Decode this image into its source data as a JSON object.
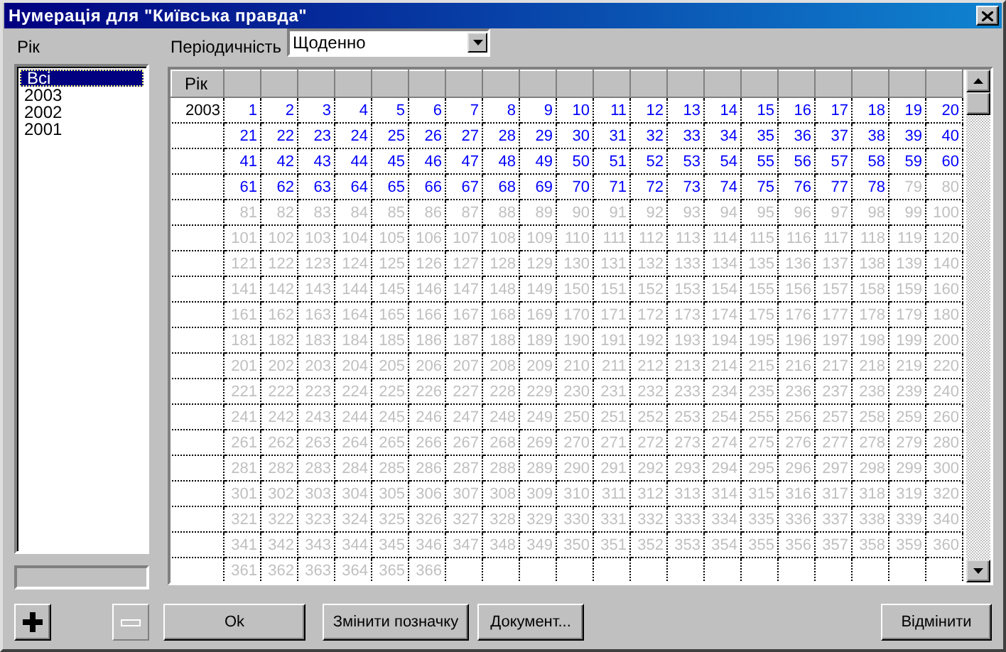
{
  "window": {
    "title": "Нумерація для \"Київська правда\""
  },
  "year_panel": {
    "label": "Рік",
    "items": [
      {
        "label": "Всі",
        "selected": true
      },
      {
        "label": "2003",
        "selected": false
      },
      {
        "label": "2002",
        "selected": false
      },
      {
        "label": "2001",
        "selected": false
      }
    ]
  },
  "periodicity": {
    "label": "Періодичність",
    "value": "Щоденно"
  },
  "grid": {
    "year_header": "Рік",
    "rows": [
      {
        "year": "2003",
        "cells": [
          {
            "number": "1",
            "issued": true
          },
          {
            "number": "2",
            "issued": true
          },
          {
            "number": "3",
            "issued": true
          },
          {
            "number": "4",
            "issued": true
          },
          {
            "number": "5",
            "issued": true
          },
          {
            "number": "6",
            "issued": true
          },
          {
            "number": "7",
            "issued": true
          },
          {
            "number": "8",
            "issued": true
          },
          {
            "number": "9",
            "issued": true
          },
          {
            "number": "10",
            "issued": true
          },
          {
            "number": "11",
            "issued": true
          },
          {
            "number": "12",
            "issued": true
          },
          {
            "number": "13",
            "issued": true
          },
          {
            "number": "14",
            "issued": true
          },
          {
            "number": "15",
            "issued": true
          },
          {
            "number": "16",
            "issued": true
          },
          {
            "number": "17",
            "issued": true
          },
          {
            "number": "18",
            "issued": true
          },
          {
            "number": "19",
            "issued": true
          },
          {
            "number": "20",
            "issued": true
          }
        ]
      },
      {
        "cells": [
          {
            "number": "21",
            "issued": true
          },
          {
            "number": "22",
            "issued": true
          },
          {
            "number": "23",
            "issued": true
          },
          {
            "number": "24",
            "issued": true
          },
          {
            "number": "25",
            "issued": true
          },
          {
            "number": "26",
            "issued": true
          },
          {
            "number": "27",
            "issued": true
          },
          {
            "number": "28",
            "issued": true
          },
          {
            "number": "29",
            "issued": true
          },
          {
            "number": "30",
            "issued": true
          },
          {
            "number": "31",
            "issued": true
          },
          {
            "number": "32",
            "issued": true
          },
          {
            "number": "33",
            "issued": true
          },
          {
            "number": "34",
            "issued": true
          },
          {
            "number": "35",
            "issued": true
          },
          {
            "number": "36",
            "issued": true
          },
          {
            "number": "37",
            "issued": true
          },
          {
            "number": "38",
            "issued": true
          },
          {
            "number": "39",
            "issued": true
          },
          {
            "number": "40",
            "issued": true
          }
        ]
      },
      {
        "cells": [
          {
            "number": "41",
            "issued": true
          },
          {
            "number": "42",
            "issued": true
          },
          {
            "number": "43",
            "issued": true
          },
          {
            "number": "44",
            "issued": true
          },
          {
            "number": "45",
            "issued": true
          },
          {
            "number": "46",
            "issued": true
          },
          {
            "number": "47",
            "issued": true
          },
          {
            "number": "48",
            "issued": true
          },
          {
            "number": "49",
            "issued": true
          },
          {
            "number": "50",
            "issued": true
          },
          {
            "number": "51",
            "issued": true
          },
          {
            "number": "52",
            "issued": true
          },
          {
            "number": "53",
            "issued": true
          },
          {
            "number": "54",
            "issued": true
          },
          {
            "number": "55",
            "issued": true
          },
          {
            "number": "56",
            "issued": true
          },
          {
            "number": "57",
            "issued": true
          },
          {
            "number": "58",
            "issued": true
          },
          {
            "number": "59",
            "issued": true
          },
          {
            "number": "60",
            "issued": true
          }
        ]
      },
      {
        "cells": [
          {
            "number": "61",
            "issued": true
          },
          {
            "number": "62",
            "issued": true
          },
          {
            "number": "63",
            "issued": true
          },
          {
            "number": "64",
            "issued": true
          },
          {
            "number": "65",
            "issued": true
          },
          {
            "number": "66",
            "issued": true
          },
          {
            "number": "67",
            "issued": true
          },
          {
            "number": "68",
            "issued": true
          },
          {
            "number": "69",
            "issued": true
          },
          {
            "number": "70",
            "issued": true
          },
          {
            "number": "71",
            "issued": true
          },
          {
            "number": "72",
            "issued": true
          },
          {
            "number": "73",
            "issued": true
          },
          {
            "number": "74",
            "issued": true
          },
          {
            "number": "75",
            "issued": true
          },
          {
            "number": "76",
            "issued": true
          },
          {
            "number": "77",
            "issued": true
          },
          {
            "number": "78",
            "issued": true
          },
          {
            "number": "79",
            "issued": false
          },
          {
            "number": "80",
            "issued": false
          }
        ]
      },
      {
        "cells": [
          {
            "number": "81",
            "issued": false
          },
          {
            "number": "82",
            "issued": false
          },
          {
            "number": "83",
            "issued": false
          },
          {
            "number": "84",
            "issued": false
          },
          {
            "number": "85",
            "issued": false
          },
          {
            "number": "86",
            "issued": false
          },
          {
            "number": "87",
            "issued": false
          },
          {
            "number": "88",
            "issued": false
          },
          {
            "number": "89",
            "issued": false
          },
          {
            "number": "90",
            "issued": false
          },
          {
            "number": "91",
            "issued": false
          },
          {
            "number": "92",
            "issued": false
          },
          {
            "number": "93",
            "issued": false
          },
          {
            "number": "94",
            "issued": false
          },
          {
            "number": "95",
            "issued": false
          },
          {
            "number": "96",
            "issued": false
          },
          {
            "number": "97",
            "issued": false
          },
          {
            "number": "98",
            "issued": false
          },
          {
            "number": "99",
            "issued": false
          },
          {
            "number": "100",
            "issued": false
          }
        ]
      },
      {
        "cells": [
          {
            "number": "101",
            "issued": false
          },
          {
            "number": "102",
            "issued": false
          },
          {
            "number": "103",
            "issued": false
          },
          {
            "number": "104",
            "issued": false
          },
          {
            "number": "105",
            "issued": false
          },
          {
            "number": "106",
            "issued": false
          },
          {
            "number": "107",
            "issued": false
          },
          {
            "number": "108",
            "issued": false
          },
          {
            "number": "109",
            "issued": false
          },
          {
            "number": "110",
            "issued": false
          },
          {
            "number": "111",
            "issued": false
          },
          {
            "number": "112",
            "issued": false
          },
          {
            "number": "113",
            "issued": false
          },
          {
            "number": "114",
            "issued": false
          },
          {
            "number": "115",
            "issued": false
          },
          {
            "number": "116",
            "issued": false
          },
          {
            "number": "117",
            "issued": false
          },
          {
            "number": "118",
            "issued": false
          },
          {
            "number": "119",
            "issued": false
          },
          {
            "number": "120",
            "issued": false
          }
        ]
      },
      {
        "cells": [
          {
            "number": "121",
            "issued": false
          },
          {
            "number": "122",
            "issued": false
          },
          {
            "number": "123",
            "issued": false
          },
          {
            "number": "124",
            "issued": false
          },
          {
            "number": "125",
            "issued": false
          },
          {
            "number": "126",
            "issued": false
          },
          {
            "number": "127",
            "issued": false
          },
          {
            "number": "128",
            "issued": false
          },
          {
            "number": "129",
            "issued": false
          },
          {
            "number": "130",
            "issued": false
          },
          {
            "number": "131",
            "issued": false
          },
          {
            "number": "132",
            "issued": false
          },
          {
            "number": "133",
            "issued": false
          },
          {
            "number": "134",
            "issued": false
          },
          {
            "number": "135",
            "issued": false
          },
          {
            "number": "136",
            "issued": false
          },
          {
            "number": "137",
            "issued": false
          },
          {
            "number": "138",
            "issued": false
          },
          {
            "number": "139",
            "issued": false
          },
          {
            "number": "140",
            "issued": false
          }
        ]
      },
      {
        "cells": [
          {
            "number": "141",
            "issued": false
          },
          {
            "number": "142",
            "issued": false
          },
          {
            "number": "143",
            "issued": false
          },
          {
            "number": "144",
            "issued": false
          },
          {
            "number": "145",
            "issued": false
          },
          {
            "number": "146",
            "issued": false
          },
          {
            "number": "147",
            "issued": false
          },
          {
            "number": "148",
            "issued": false
          },
          {
            "number": "149",
            "issued": false
          },
          {
            "number": "150",
            "issued": false
          },
          {
            "number": "151",
            "issued": false
          },
          {
            "number": "152",
            "issued": false
          },
          {
            "number": "153",
            "issued": false
          },
          {
            "number": "154",
            "issued": false
          },
          {
            "number": "155",
            "issued": false
          },
          {
            "number": "156",
            "issued": false
          },
          {
            "number": "157",
            "issued": false
          },
          {
            "number": "158",
            "issued": false
          },
          {
            "number": "159",
            "issued": false
          },
          {
            "number": "160",
            "issued": false
          }
        ]
      },
      {
        "cells": [
          {
            "number": "161",
            "issued": false
          },
          {
            "number": "162",
            "issued": false
          },
          {
            "number": "163",
            "issued": false
          },
          {
            "number": "164",
            "issued": false
          },
          {
            "number": "165",
            "issued": false
          },
          {
            "number": "166",
            "issued": false
          },
          {
            "number": "167",
            "issued": false
          },
          {
            "number": "168",
            "issued": false
          },
          {
            "number": "169",
            "issued": false
          },
          {
            "number": "170",
            "issued": false
          },
          {
            "number": "171",
            "issued": false
          },
          {
            "number": "172",
            "issued": false
          },
          {
            "number": "173",
            "issued": false
          },
          {
            "number": "174",
            "issued": false
          },
          {
            "number": "175",
            "issued": false
          },
          {
            "number": "176",
            "issued": false
          },
          {
            "number": "177",
            "issued": false
          },
          {
            "number": "178",
            "issued": false
          },
          {
            "number": "179",
            "issued": false
          },
          {
            "number": "180",
            "issued": false
          }
        ]
      },
      {
        "cells": [
          {
            "number": "181",
            "issued": false
          },
          {
            "number": "182",
            "issued": false
          },
          {
            "number": "183",
            "issued": false
          },
          {
            "number": "184",
            "issued": false
          },
          {
            "number": "185",
            "issued": false
          },
          {
            "number": "186",
            "issued": false
          },
          {
            "number": "187",
            "issued": false
          },
          {
            "number": "188",
            "issued": false
          },
          {
            "number": "189",
            "issued": false
          },
          {
            "number": "190",
            "issued": false
          },
          {
            "number": "191",
            "issued": false
          },
          {
            "number": "192",
            "issued": false
          },
          {
            "number": "193",
            "issued": false
          },
          {
            "number": "194",
            "issued": false
          },
          {
            "number": "195",
            "issued": false
          },
          {
            "number": "196",
            "issued": false
          },
          {
            "number": "197",
            "issued": false
          },
          {
            "number": "198",
            "issued": false
          },
          {
            "number": "199",
            "issued": false
          },
          {
            "number": "200",
            "issued": false
          }
        ]
      },
      {
        "cells": [
          {
            "number": "201",
            "issued": false
          },
          {
            "number": "202",
            "issued": false
          },
          {
            "number": "203",
            "issued": false
          },
          {
            "number": "204",
            "issued": false
          },
          {
            "number": "205",
            "issued": false
          },
          {
            "number": "206",
            "issued": false
          },
          {
            "number": "207",
            "issued": false
          },
          {
            "number": "208",
            "issued": false
          },
          {
            "number": "209",
            "issued": false
          },
          {
            "number": "210",
            "issued": false
          },
          {
            "number": "211",
            "issued": false
          },
          {
            "number": "212",
            "issued": false
          },
          {
            "number": "213",
            "issued": false
          },
          {
            "number": "214",
            "issued": false
          },
          {
            "number": "215",
            "issued": false
          },
          {
            "number": "216",
            "issued": false
          },
          {
            "number": "217",
            "issued": false
          },
          {
            "number": "218",
            "issued": false
          },
          {
            "number": "219",
            "issued": false
          },
          {
            "number": "220",
            "issued": false
          }
        ]
      },
      {
        "cells": [
          {
            "number": "221",
            "issued": false
          },
          {
            "number": "222",
            "issued": false
          },
          {
            "number": "223",
            "issued": false
          },
          {
            "number": "224",
            "issued": false
          },
          {
            "number": "225",
            "issued": false
          },
          {
            "number": "226",
            "issued": false
          },
          {
            "number": "227",
            "issued": false
          },
          {
            "number": "228",
            "issued": false
          },
          {
            "number": "229",
            "issued": false
          },
          {
            "number": "230",
            "issued": false
          },
          {
            "number": "231",
            "issued": false
          },
          {
            "number": "232",
            "issued": false
          },
          {
            "number": "233",
            "issued": false
          },
          {
            "number": "234",
            "issued": false
          },
          {
            "number": "235",
            "issued": false
          },
          {
            "number": "236",
            "issued": false
          },
          {
            "number": "237",
            "issued": false
          },
          {
            "number": "238",
            "issued": false
          },
          {
            "number": "239",
            "issued": false
          },
          {
            "number": "240",
            "issued": false
          }
        ]
      },
      {
        "cells": [
          {
            "number": "241",
            "issued": false
          },
          {
            "number": "242",
            "issued": false
          },
          {
            "number": "243",
            "issued": false
          },
          {
            "number": "244",
            "issued": false
          },
          {
            "number": "245",
            "issued": false
          },
          {
            "number": "246",
            "issued": false
          },
          {
            "number": "247",
            "issued": false
          },
          {
            "number": "248",
            "issued": false
          },
          {
            "number": "249",
            "issued": false
          },
          {
            "number": "250",
            "issued": false
          },
          {
            "number": "251",
            "issued": false
          },
          {
            "number": "252",
            "issued": false
          },
          {
            "number": "253",
            "issued": false
          },
          {
            "number": "254",
            "issued": false
          },
          {
            "number": "255",
            "issued": false
          },
          {
            "number": "256",
            "issued": false
          },
          {
            "number": "257",
            "issued": false
          },
          {
            "number": "258",
            "issued": false
          },
          {
            "number": "259",
            "issued": false
          },
          {
            "number": "260",
            "issued": false
          }
        ]
      },
      {
        "cells": [
          {
            "number": "261",
            "issued": false
          },
          {
            "number": "262",
            "issued": false
          },
          {
            "number": "263",
            "issued": false
          },
          {
            "number": "264",
            "issued": false
          },
          {
            "number": "265",
            "issued": false
          },
          {
            "number": "266",
            "issued": false
          },
          {
            "number": "267",
            "issued": false
          },
          {
            "number": "268",
            "issued": false
          },
          {
            "number": "269",
            "issued": false
          },
          {
            "number": "270",
            "issued": false
          },
          {
            "number": "271",
            "issued": false
          },
          {
            "number": "272",
            "issued": false
          },
          {
            "number": "273",
            "issued": false
          },
          {
            "number": "274",
            "issued": false
          },
          {
            "number": "275",
            "issued": false
          },
          {
            "number": "276",
            "issued": false
          },
          {
            "number": "277",
            "issued": false
          },
          {
            "number": "278",
            "issued": false
          },
          {
            "number": "279",
            "issued": false
          },
          {
            "number": "280",
            "issued": false
          }
        ]
      },
      {
        "cells": [
          {
            "number": "281",
            "issued": false
          },
          {
            "number": "282",
            "issued": false
          },
          {
            "number": "283",
            "issued": false
          },
          {
            "number": "284",
            "issued": false
          },
          {
            "number": "285",
            "issued": false
          },
          {
            "number": "286",
            "issued": false
          },
          {
            "number": "287",
            "issued": false
          },
          {
            "number": "288",
            "issued": false
          },
          {
            "number": "289",
            "issued": false
          },
          {
            "number": "290",
            "issued": false
          },
          {
            "number": "291",
            "issued": false
          },
          {
            "number": "292",
            "issued": false
          },
          {
            "number": "293",
            "issued": false
          },
          {
            "number": "294",
            "issued": false
          },
          {
            "number": "295",
            "issued": false
          },
          {
            "number": "296",
            "issued": false
          },
          {
            "number": "297",
            "issued": false
          },
          {
            "number": "298",
            "issued": false
          },
          {
            "number": "299",
            "issued": false
          },
          {
            "number": "300",
            "issued": false
          }
        ]
      },
      {
        "cells": [
          {
            "number": "301",
            "issued": false
          },
          {
            "number": "302",
            "issued": false
          },
          {
            "number": "303",
            "issued": false
          },
          {
            "number": "304",
            "issued": false
          },
          {
            "number": "305",
            "issued": false
          },
          {
            "number": "306",
            "issued": false
          },
          {
            "number": "307",
            "issued": false
          },
          {
            "number": "308",
            "issued": false
          },
          {
            "number": "309",
            "issued": false
          },
          {
            "number": "310",
            "issued": false
          },
          {
            "number": "311",
            "issued": false
          },
          {
            "number": "312",
            "issued": false
          },
          {
            "number": "313",
            "issued": false
          },
          {
            "number": "314",
            "issued": false
          },
          {
            "number": "315",
            "issued": false
          },
          {
            "number": "316",
            "issued": false
          },
          {
            "number": "317",
            "issued": false
          },
          {
            "number": "318",
            "issued": false
          },
          {
            "number": "319",
            "issued": false
          },
          {
            "number": "320",
            "issued": false
          }
        ]
      },
      {
        "cells": [
          {
            "number": "321",
            "issued": false
          },
          {
            "number": "322",
            "issued": false
          },
          {
            "number": "323",
            "issued": false
          },
          {
            "number": "324",
            "issued": false
          },
          {
            "number": "325",
            "issued": false
          },
          {
            "number": "326",
            "issued": false
          },
          {
            "number": "327",
            "issued": false
          },
          {
            "number": "328",
            "issued": false
          },
          {
            "number": "329",
            "issued": false
          },
          {
            "number": "330",
            "issued": false
          },
          {
            "number": "331",
            "issued": false
          },
          {
            "number": "332",
            "issued": false
          },
          {
            "number": "333",
            "issued": false
          },
          {
            "number": "334",
            "issued": false
          },
          {
            "number": "335",
            "issued": false
          },
          {
            "number": "336",
            "issued": false
          },
          {
            "number": "337",
            "issued": false
          },
          {
            "number": "338",
            "issued": false
          },
          {
            "number": "339",
            "issued": false
          },
          {
            "number": "340",
            "issued": false
          }
        ]
      },
      {
        "cells": [
          {
            "number": "341",
            "issued": false
          },
          {
            "number": "342",
            "issued": false
          },
          {
            "number": "343",
            "issued": false
          },
          {
            "number": "344",
            "issued": false
          },
          {
            "number": "345",
            "issued": false
          },
          {
            "number": "346",
            "issued": false
          },
          {
            "number": "347",
            "issued": false
          },
          {
            "number": "348",
            "issued": false
          },
          {
            "number": "349",
            "issued": false
          },
          {
            "number": "350",
            "issued": false
          },
          {
            "number": "351",
            "issued": false
          },
          {
            "number": "352",
            "issued": false
          },
          {
            "number": "353",
            "issued": false
          },
          {
            "number": "354",
            "issued": false
          },
          {
            "number": "355",
            "issued": false
          },
          {
            "number": "356",
            "issued": false
          },
          {
            "number": "357",
            "issued": false
          },
          {
            "number": "358",
            "issued": false
          },
          {
            "number": "359",
            "issued": false
          },
          {
            "number": "360",
            "issued": false
          }
        ]
      },
      {
        "cells": [
          {
            "number": "361",
            "issued": false
          },
          {
            "number": "362",
            "issued": false
          },
          {
            "number": "363",
            "issued": false
          },
          {
            "number": "364",
            "issued": false
          },
          {
            "number": "365",
            "issued": false
          },
          {
            "number": "366",
            "issued": false
          }
        ]
      }
    ]
  },
  "buttons": [
    {
      "kind": "add",
      "disabled": false
    },
    {
      "kind": "remove",
      "disabled": true
    },
    {
      "kind": "text",
      "label": "Ok"
    },
    {
      "kind": "text",
      "label": "Змінити позначку"
    },
    {
      "kind": "text",
      "label": "Документ..."
    },
    {
      "kind": "text",
      "label": "Відмінити"
    }
  ]
}
